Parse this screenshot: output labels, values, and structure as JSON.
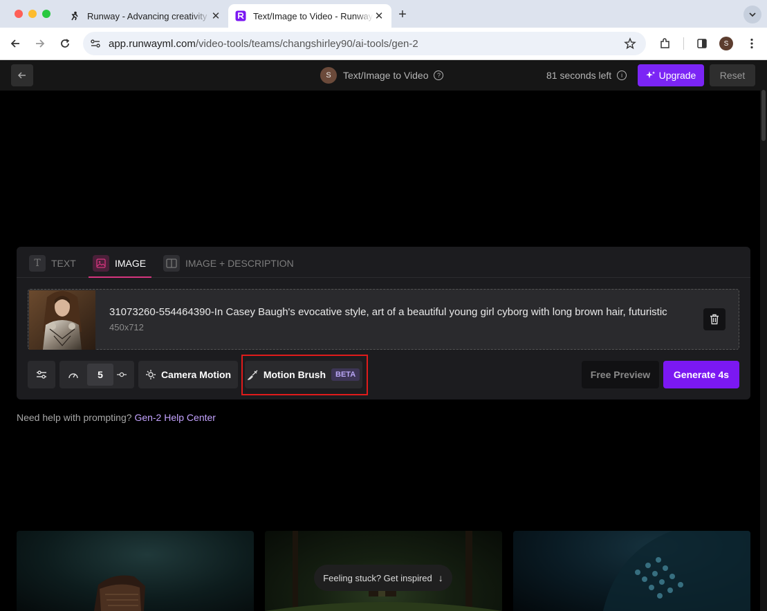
{
  "browser": {
    "tabs": [
      {
        "title": "Runway - Advancing creativity"
      },
      {
        "title": "Text/Image to Video - Runway"
      }
    ],
    "url_host": "app.runwayml.com",
    "url_path": "/video-tools/teams/changshirley90/ai-tools/gen-2",
    "profile_initial": "S"
  },
  "header": {
    "avatar_initial": "S",
    "title": "Text/Image to Video",
    "time_left": "81 seconds left",
    "upgrade_label": "Upgrade",
    "reset_label": "Reset"
  },
  "mode_tabs": [
    {
      "label": "TEXT",
      "glyph": "T",
      "active": false
    },
    {
      "label": "IMAGE",
      "active": true
    },
    {
      "label": "IMAGE + DESCRIPTION",
      "active": false
    }
  ],
  "image": {
    "name": "31073260-554464390-In Casey Baugh's evocative style, art of a beautiful young girl cyborg with long brown hair, futuristic",
    "size": "450x712"
  },
  "controls": {
    "speed_value": "5",
    "camera_motion_label": "Camera Motion",
    "motion_brush_label": "Motion Brush",
    "beta_badge": "BETA",
    "free_preview_label": "Free Preview",
    "generate_label": "Generate 4s"
  },
  "help": {
    "prefix": "Need help with prompting?",
    "link": "Gen-2 Help Center"
  },
  "inspire_label": "Feeling stuck? Get inspired",
  "colors": {
    "accent": "#7b18f2",
    "active_tab_underline": "#d6367f",
    "highlight_box": "#e01b1b"
  }
}
